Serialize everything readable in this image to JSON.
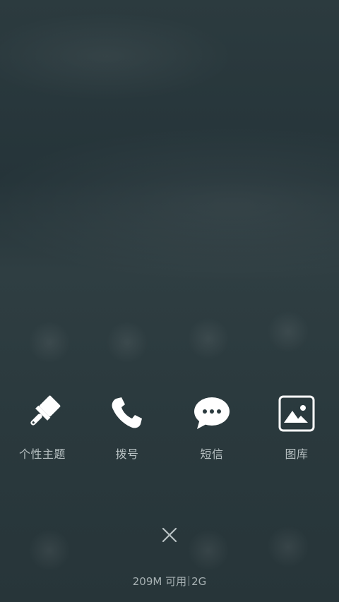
{
  "apps": [
    {
      "name": "theme",
      "label": "个性主题",
      "icon": "paintbrush-icon"
    },
    {
      "name": "phone",
      "label": "拨号",
      "icon": "phone-icon"
    },
    {
      "name": "messages",
      "label": "短信",
      "icon": "message-bubble-icon"
    },
    {
      "name": "gallery",
      "label": "图库",
      "icon": "gallery-icon"
    }
  ],
  "close": {
    "icon": "close-icon"
  },
  "memory": {
    "available": "209M 可用",
    "network": "2G"
  },
  "colors": {
    "label": "#b7c0c2",
    "icon": "#ffffff",
    "background": "#2b3a3e"
  }
}
